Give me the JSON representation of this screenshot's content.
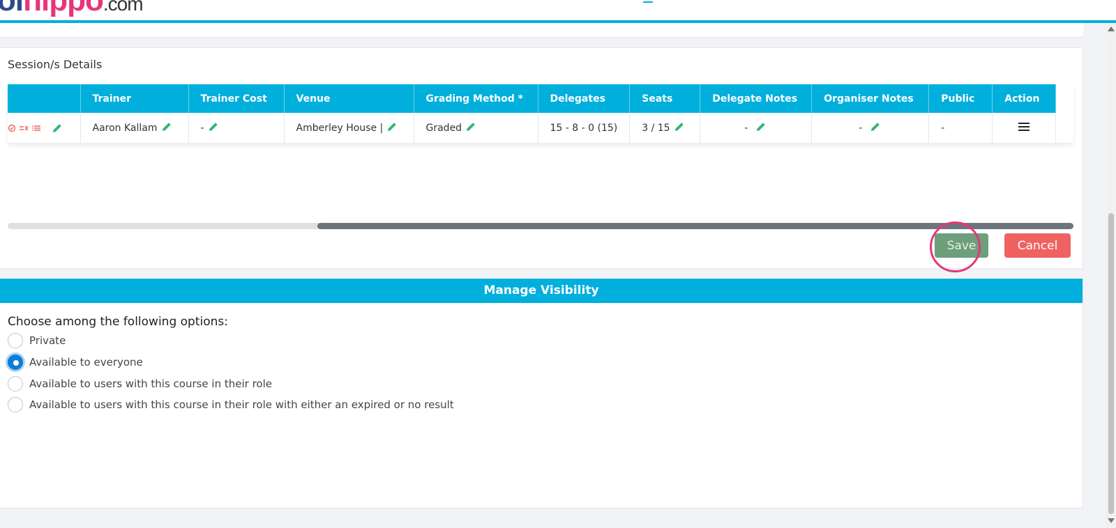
{
  "brand": {
    "part1": "ol",
    "part2": "hippo",
    "part3": ".com"
  },
  "session": {
    "title": "Session/s Details",
    "columns": [
      "",
      "Trainer",
      "Trainer Cost",
      "Venue",
      "Grading Method *",
      "Delegates",
      "Seats",
      "Delegate Notes",
      "Organiser Notes",
      "Public",
      "Action"
    ],
    "row": {
      "trainer": "Aaron Kallam",
      "trainer_cost": "-",
      "venue": "Amberley House |",
      "grading": "Graded",
      "delegates": "15 - 8 - 0 (15)",
      "seats": "3 / 15",
      "delegate_notes": "-",
      "organiser_notes": "-",
      "public": "-"
    },
    "save_label": "Save",
    "cancel_label": "Cancel"
  },
  "visibility": {
    "header": "Manage Visibility",
    "prompt": "Choose among the following options:",
    "options": [
      {
        "label": "Private",
        "checked": false
      },
      {
        "label": "Available to everyone",
        "checked": true
      },
      {
        "label": "Available to users with this course in their role",
        "checked": false
      },
      {
        "label": "Available to users with this course in their role with either an expired or no result",
        "checked": false
      }
    ]
  },
  "colors": {
    "accent": "#00afdc",
    "edit": "#2eb872",
    "danger": "#f06262",
    "save": "#6c9f7a"
  }
}
